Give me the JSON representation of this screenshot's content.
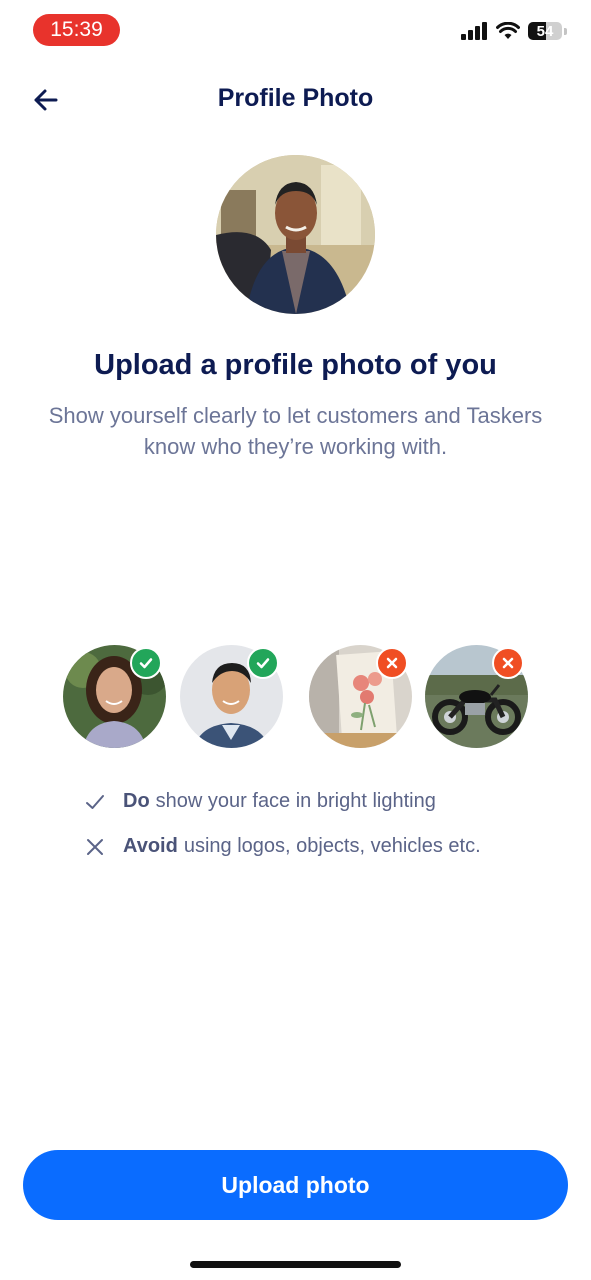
{
  "status_bar": {
    "time": "15:39",
    "battery": "54",
    "battery_level": 0.54
  },
  "header": {
    "title": "Profile Photo"
  },
  "main": {
    "headline": "Upload a profile photo of you",
    "subtext": "Show yourself clearly to let customers and Taskers know who they’re working with."
  },
  "examples": [
    {
      "kind": "good",
      "subject": "woman-smiling",
      "badge": "check-icon"
    },
    {
      "kind": "good",
      "subject": "man-smiling",
      "badge": "check-icon"
    },
    {
      "kind": "bad",
      "subject": "flower-painting",
      "badge": "close-icon"
    },
    {
      "kind": "bad",
      "subject": "motorcycle",
      "badge": "close-icon"
    }
  ],
  "rules": [
    {
      "icon": "check-icon",
      "strong": "Do",
      "text": "show your face in bright lighting"
    },
    {
      "icon": "close-icon",
      "strong": "Avoid",
      "text": "using logos, objects, vehicles etc."
    }
  ],
  "actions": {
    "upload_label": "Upload photo"
  },
  "colors": {
    "accent": "#0a6cff",
    "good": "#22a65a",
    "bad": "#f04e23",
    "title": "#0d1b52",
    "time_pill": "#e8332c"
  }
}
